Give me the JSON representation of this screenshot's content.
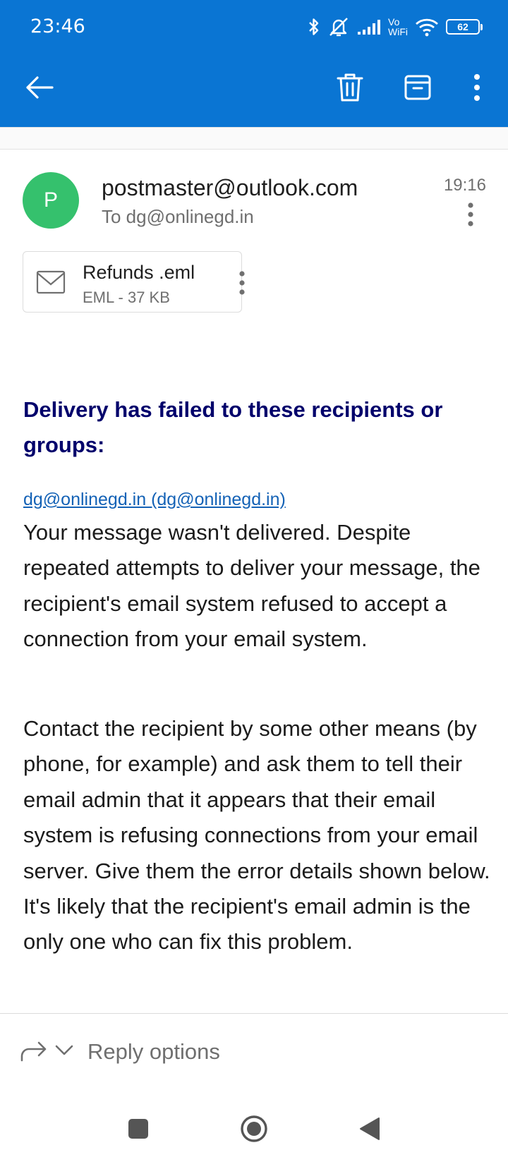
{
  "status_bar": {
    "time": "23:46",
    "network_label_top": "Vo",
    "network_label_bottom": "WiFi",
    "battery": "62"
  },
  "toolbar": {
    "back_icon": "arrow-left-icon",
    "delete_icon": "trash-icon",
    "archive_icon": "archive-icon",
    "more_icon": "more-vertical-icon"
  },
  "message": {
    "avatar_initial": "P",
    "sender": "postmaster@outlook.com",
    "recipient": "To dg@onlinegd.in",
    "time": "19:16",
    "avatar_color": "#35c16d"
  },
  "attachment": {
    "name": "Refunds .eml",
    "meta": "EML - 37 KB",
    "icon": "mail-envelope-icon"
  },
  "body": {
    "heading": "Delivery has failed to these recipients or groups:",
    "recipient_link": "dg@onlinegd.in (dg@onlinegd.in)",
    "paragraph_1": "Your message wasn't delivered. Despite repeated attempts to deliver your message, the recipient's email system refused to accept a connection from your email system.",
    "paragraph_2": "Contact the recipient by some other means (by phone, for example) and ask them to tell their email admin that it appears that their email system is refusing connections from your email server. Give them the error details shown below. It's likely that the recipient's email admin is the only one who can fix this problem."
  },
  "reply_bar": {
    "label": "Reply options"
  },
  "colors": {
    "app_bar": "#0a75d3",
    "heading": "#00006b",
    "link": "#1462b6"
  }
}
